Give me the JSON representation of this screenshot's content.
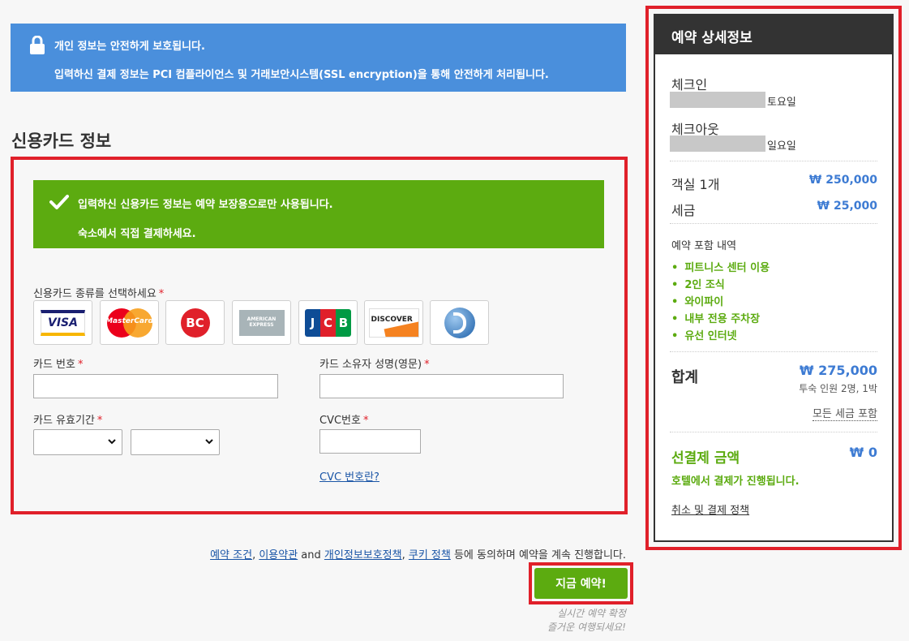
{
  "notice": {
    "line1": "개인 정보는 안전하게 보호됩니다.",
    "line2": "입력하신 결제 정보는 PCI 컴플라이언스 및 거래보안시스템(SSL encryption)을 통해 안전하게 처리됩니다."
  },
  "section_title": "신용카드 정보",
  "card_form": {
    "note_line1": "입력하신 신용카드 정보는 예약 보장용으로만 사용됩니다.",
    "note_line2": "숙소에서 직접 결제하세요.",
    "card_type_label": "신용카드 종류를 선택하세요",
    "cards": [
      {
        "name": "VISA",
        "color": "#1a1f71"
      },
      {
        "name": "MasterCard",
        "color": "#eb001b"
      },
      {
        "name": "BC",
        "color": "#e0202a"
      },
      {
        "name": "AMERICAN EXPRESS",
        "color": "#2e77bb"
      },
      {
        "name": "JCB",
        "color": "#0e4c96"
      },
      {
        "name": "DISCOVER",
        "color": "#f58220"
      },
      {
        "name": "Shinhan",
        "color": "#1b5fa8"
      }
    ],
    "card_number_label": "카드 번호",
    "card_holder_label": "카드 소유자 성명(영문)",
    "expiry_label": "카드 유효기간",
    "cvc_label": "CVC번호",
    "cvc_help": "CVC 번호란?",
    "required_mark": "*"
  },
  "terms": {
    "link1": "예약 조건",
    "sep1": ", ",
    "link2": "이용약관",
    "and": " and ",
    "link3": "개인정보보호정책",
    "sep2": ", ",
    "link4": "쿠키 정책",
    "tail": " 등에 동의하며 예약을 계속 진행합니다."
  },
  "book_button": "지금 예약!",
  "book_sub1": "실시간 예약 확정",
  "book_sub2": "즐거운 여행되세요!",
  "summary": {
    "title": "예약 상세정보",
    "checkin_label": "체크인",
    "checkin_day": "토요일",
    "checkout_label": "체크아웃",
    "checkout_day": "일요일",
    "room_label": "객실 1개",
    "room_price": "₩ 250,000",
    "tax_label": "세금",
    "tax_price": "₩ 25,000",
    "includes_title": "예약 포함 내역",
    "includes": [
      "피트니스 센터 이용",
      "2인 조식",
      "와이파이",
      "내부 전용 주차장",
      "유선 인터넷"
    ],
    "total_label": "합계",
    "total_price": "₩ 275,000",
    "total_note": "투숙 인원 2명, 1박",
    "tax_included": "모든 세금 포함",
    "prepay_label": "선결제 금액",
    "prepay_price": "₩ 0",
    "prepay_note": "호텔에서 결제가 진행됩니다.",
    "policy_link": "취소 및 결제 정책"
  }
}
